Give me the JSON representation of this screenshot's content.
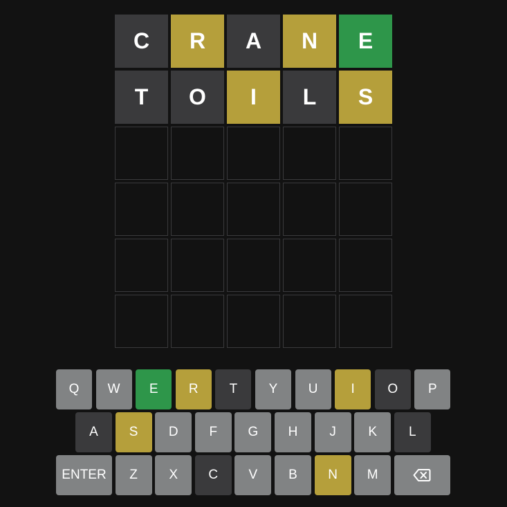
{
  "colors": {
    "background": "#121212",
    "absent": "#3a3a3c",
    "present": "#b59f3b",
    "correct": "#2e964a",
    "unused_key": "#818384",
    "empty_border": "#3a3a3c"
  },
  "board": {
    "rows": [
      [
        {
          "letter": "C",
          "state": "absent"
        },
        {
          "letter": "R",
          "state": "present"
        },
        {
          "letter": "A",
          "state": "absent"
        },
        {
          "letter": "N",
          "state": "present"
        },
        {
          "letter": "E",
          "state": "correct"
        }
      ],
      [
        {
          "letter": "T",
          "state": "absent"
        },
        {
          "letter": "O",
          "state": "absent"
        },
        {
          "letter": "I",
          "state": "present"
        },
        {
          "letter": "L",
          "state": "absent"
        },
        {
          "letter": "S",
          "state": "present"
        }
      ],
      [
        {
          "letter": "",
          "state": "empty"
        },
        {
          "letter": "",
          "state": "empty"
        },
        {
          "letter": "",
          "state": "empty"
        },
        {
          "letter": "",
          "state": "empty"
        },
        {
          "letter": "",
          "state": "empty"
        }
      ],
      [
        {
          "letter": "",
          "state": "empty"
        },
        {
          "letter": "",
          "state": "empty"
        },
        {
          "letter": "",
          "state": "empty"
        },
        {
          "letter": "",
          "state": "empty"
        },
        {
          "letter": "",
          "state": "empty"
        }
      ],
      [
        {
          "letter": "",
          "state": "empty"
        },
        {
          "letter": "",
          "state": "empty"
        },
        {
          "letter": "",
          "state": "empty"
        },
        {
          "letter": "",
          "state": "empty"
        },
        {
          "letter": "",
          "state": "empty"
        }
      ],
      [
        {
          "letter": "",
          "state": "empty"
        },
        {
          "letter": "",
          "state": "empty"
        },
        {
          "letter": "",
          "state": "empty"
        },
        {
          "letter": "",
          "state": "empty"
        },
        {
          "letter": "",
          "state": "empty"
        }
      ]
    ]
  },
  "keyboard": {
    "rows": [
      [
        {
          "label": "Q",
          "state": "unused"
        },
        {
          "label": "W",
          "state": "unused"
        },
        {
          "label": "E",
          "state": "correct"
        },
        {
          "label": "R",
          "state": "present"
        },
        {
          "label": "T",
          "state": "absent"
        },
        {
          "label": "Y",
          "state": "unused"
        },
        {
          "label": "U",
          "state": "unused"
        },
        {
          "label": "I",
          "state": "present"
        },
        {
          "label": "O",
          "state": "absent"
        },
        {
          "label": "P",
          "state": "unused"
        }
      ],
      [
        {
          "label": "A",
          "state": "absent"
        },
        {
          "label": "S",
          "state": "present"
        },
        {
          "label": "D",
          "state": "unused"
        },
        {
          "label": "F",
          "state": "unused"
        },
        {
          "label": "G",
          "state": "unused"
        },
        {
          "label": "H",
          "state": "unused"
        },
        {
          "label": "J",
          "state": "unused"
        },
        {
          "label": "K",
          "state": "unused"
        },
        {
          "label": "L",
          "state": "absent"
        }
      ],
      [
        {
          "label": "ENTER",
          "state": "unused",
          "kind": "enter"
        },
        {
          "label": "Z",
          "state": "unused"
        },
        {
          "label": "X",
          "state": "unused"
        },
        {
          "label": "C",
          "state": "absent"
        },
        {
          "label": "V",
          "state": "unused"
        },
        {
          "label": "B",
          "state": "unused"
        },
        {
          "label": "N",
          "state": "present"
        },
        {
          "label": "M",
          "state": "unused"
        },
        {
          "label": "",
          "state": "unused",
          "kind": "backspace",
          "icon": "backspace-icon"
        }
      ]
    ]
  }
}
